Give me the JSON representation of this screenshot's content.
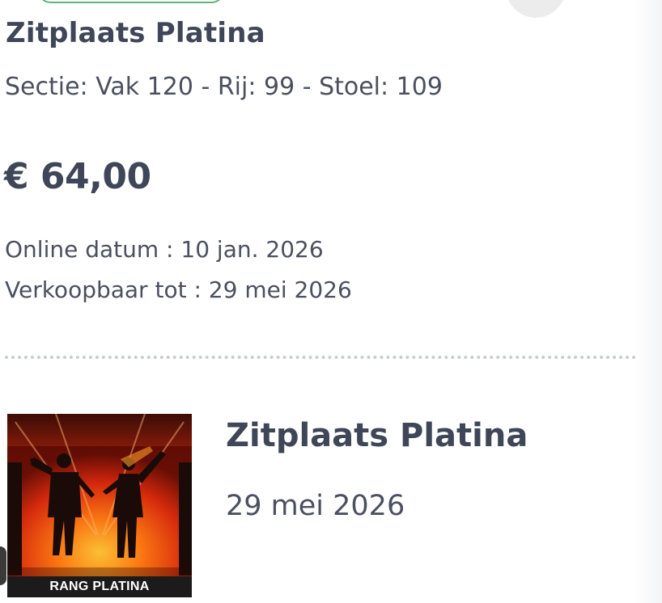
{
  "ticket": {
    "title": "Zitplaats Platina",
    "section": "Sectie: Vak 120 - Rij: 99 - Stoel: 109",
    "price": "€ 64,00",
    "online_date": "Online datum : 10 jan. 2026",
    "sellable_until": "Verkoopbaar tot : 29 mei 2026"
  },
  "event_card": {
    "image_label": "RANG PLATINA",
    "title": "Zitplaats Platina",
    "date": "29 mei 2026"
  },
  "colors": {
    "accent_green": "#63b27b",
    "text_dark": "#3f4657",
    "text_body": "#4a505f",
    "divider": "#c8ccd2"
  }
}
